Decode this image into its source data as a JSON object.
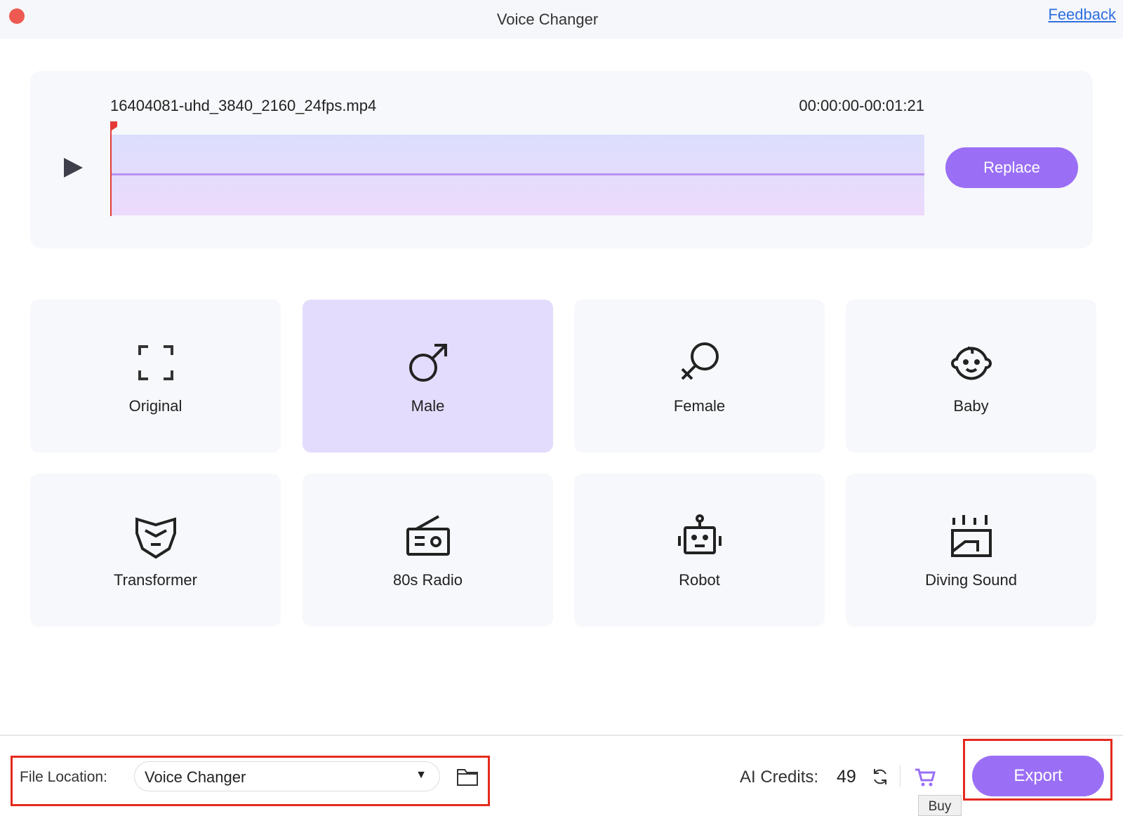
{
  "window": {
    "title": "Voice Changer",
    "feedback_link": "Feedback"
  },
  "media": {
    "filename": "16404081-uhd_3840_2160_24fps.mp4",
    "time_range": "00:00:00-00:01:21",
    "playhead_fraction": 0,
    "replace_label": "Replace"
  },
  "voices": [
    {
      "label": "Original",
      "icon": "expand-frame-icon",
      "selected": false
    },
    {
      "label": "Male",
      "icon": "male-symbol-icon",
      "selected": true
    },
    {
      "label": "Female",
      "icon": "female-symbol-icon",
      "selected": false
    },
    {
      "label": "Baby",
      "icon": "baby-face-icon",
      "selected": false
    },
    {
      "label": "Transformer",
      "icon": "transformer-mask-icon",
      "selected": false
    },
    {
      "label": "80s Radio",
      "icon": "radio-icon",
      "selected": false
    },
    {
      "label": "Robot",
      "icon": "robot-icon",
      "selected": false
    },
    {
      "label": "Diving Sound",
      "icon": "diving-sound-icon",
      "selected": false
    }
  ],
  "footer": {
    "file_location_label": "File Location:",
    "file_location_value": "Voice Changer",
    "ai_credits_label": "AI Credits:",
    "ai_credits_value": "49",
    "buy_tooltip": "Buy",
    "export_label": "Export"
  },
  "colors": {
    "accent": "#9a6ff5",
    "selected_card": "#e4dcfc",
    "highlight_box": "#e42a1d"
  }
}
